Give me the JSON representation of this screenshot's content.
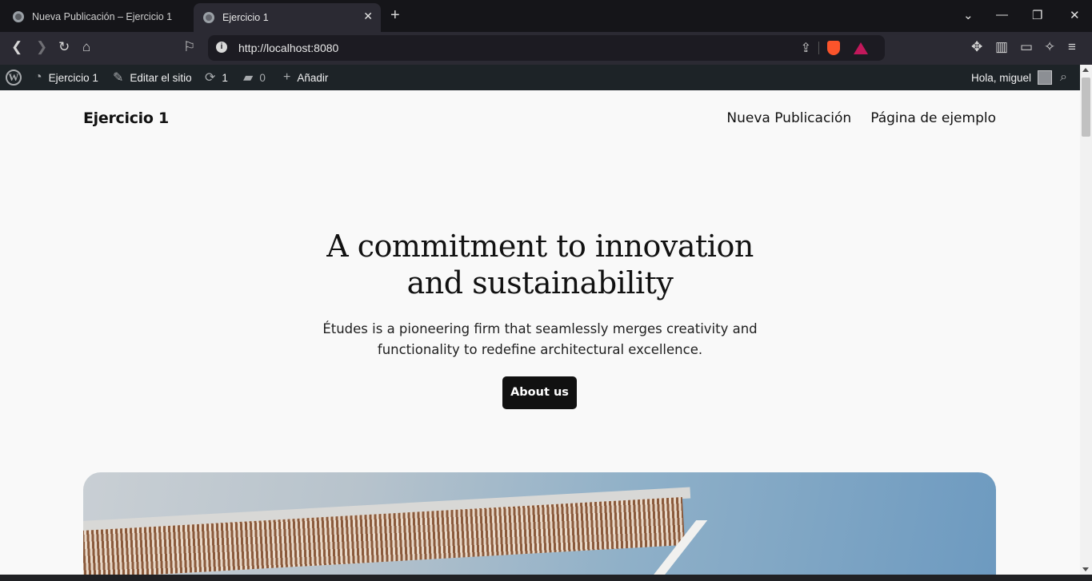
{
  "browser": {
    "tabs": [
      {
        "label": "Nueva Publicación – Ejercicio 1",
        "active": false
      },
      {
        "label": "Ejercicio 1",
        "active": true
      }
    ],
    "url": "http://localhost:8080"
  },
  "adminbar": {
    "site_name": "Ejercicio 1",
    "edit_site": "Editar el sitio",
    "updates_count": "1",
    "comments_count": "0",
    "new_label": "Añadir",
    "greeting": "Hola, miguel"
  },
  "site": {
    "title": "Ejercicio 1",
    "nav": [
      "Nueva Publicación",
      "Página de ejemplo"
    ]
  },
  "hero": {
    "title_line1": "A commitment to innovation",
    "title_line2": "and sustainability",
    "subtitle_line1": "Études is a pioneering firm that seamlessly merges creativity and",
    "subtitle_line2": "functionality to redefine architectural excellence.",
    "button": "About us"
  },
  "colors": {
    "adminbar_bg": "#1d2327",
    "page_bg": "#f9f9f9",
    "button_bg": "#111111",
    "brave_orange": "#fb542b"
  }
}
